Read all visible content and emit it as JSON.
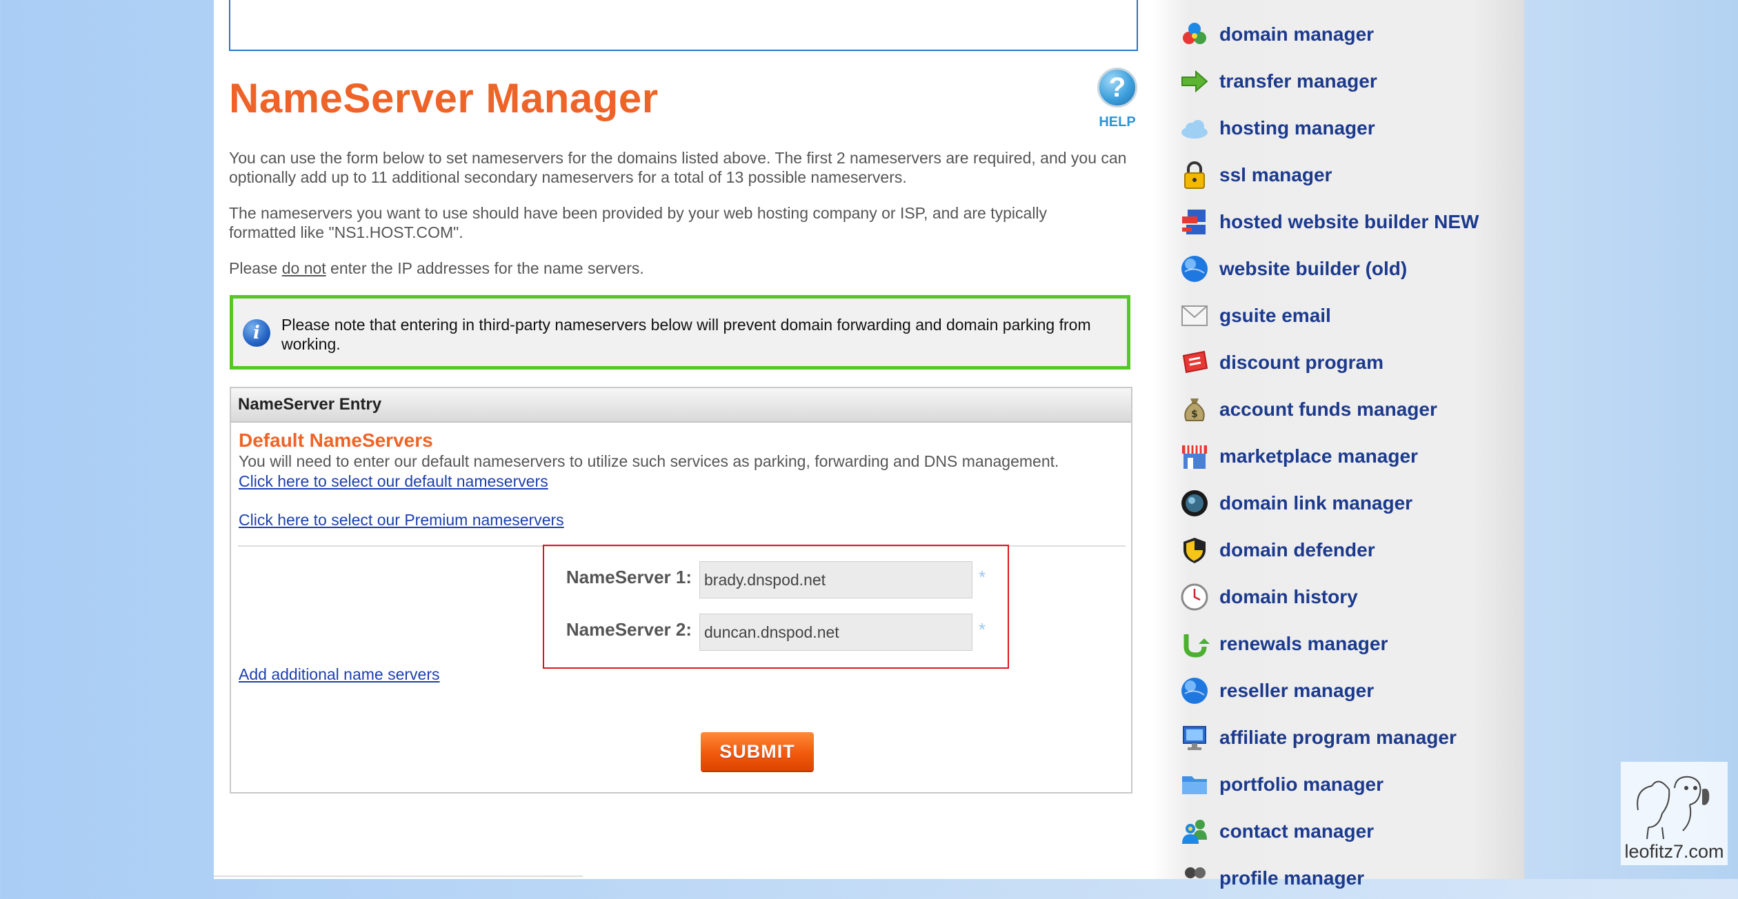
{
  "main": {
    "title": "NameServer Manager",
    "help_label": "HELP",
    "help_icon": "question-mark-icon",
    "paragraph1": "You can use the form below to set nameservers for the domains listed above. The first 2 nameservers are required, and you can optionally add up to 11 additional secondary nameservers for a total of 13 possible nameservers.",
    "paragraph2": "The nameservers you want to use should have been provided by your web hosting company or ISP, and are typically formatted like \"NS1.HOST.COM\".",
    "paragraph3_prefix": "Please ",
    "paragraph3_emphasis": "do not",
    "paragraph3_suffix": " enter the IP addresses for the name servers.",
    "notice": "Please note that entering in third-party nameservers below will prevent domain forwarding and domain parking from working.",
    "notice_icon": "info-icon"
  },
  "entry": {
    "header": "NameServer Entry",
    "default_title": "Default NameServers",
    "default_desc": "You will need to enter our default nameservers to utilize such services as parking, forwarding and DNS management.",
    "link_default": "Click here to select our default nameservers",
    "link_premium": "Click here to select our Premium nameservers",
    "ns1_label": "NameServer 1:",
    "ns1_value": "brady.dnspod.net",
    "ns2_label": "NameServer 2:",
    "ns2_value": "duncan.dnspod.net",
    "required_mark": "*",
    "link_add": "Add additional name servers",
    "submit": "SUBMIT"
  },
  "sidebar": {
    "items": [
      {
        "label": "domain manager",
        "icon": "domain-manager-icon"
      },
      {
        "label": "transfer manager",
        "icon": "arrow-right-icon"
      },
      {
        "label": "hosting manager",
        "icon": "cloud-icon"
      },
      {
        "label": "ssl manager",
        "icon": "padlock-icon"
      },
      {
        "label": "hosted website builder NEW",
        "icon": "website-builder-icon"
      },
      {
        "label": "website builder (old)",
        "icon": "globe-icon"
      },
      {
        "label": "gsuite email",
        "icon": "envelope-icon"
      },
      {
        "label": "discount program",
        "icon": "coupon-icon"
      },
      {
        "label": "account funds manager",
        "icon": "money-bag-icon"
      },
      {
        "label": "marketplace manager",
        "icon": "storefront-icon"
      },
      {
        "label": "domain link manager",
        "icon": "link-globe-icon"
      },
      {
        "label": "domain defender",
        "icon": "shield-icon"
      },
      {
        "label": "domain history",
        "icon": "clock-icon"
      },
      {
        "label": "renewals manager",
        "icon": "renew-arrow-icon"
      },
      {
        "label": "reseller manager",
        "icon": "globe-icon"
      },
      {
        "label": "affiliate program manager",
        "icon": "monitor-icon"
      },
      {
        "label": "portfolio manager",
        "icon": "folder-icon"
      },
      {
        "label": "contact manager",
        "icon": "contacts-icon"
      },
      {
        "label": "profile manager",
        "icon": "profile-icon"
      }
    ]
  },
  "watermark": {
    "text": "leofitz7.com"
  },
  "colors": {
    "title_orange": "#ee6327",
    "sidebar_link": "#1c3a8d",
    "notice_border": "#57c728",
    "highlight_red": "#e0141e",
    "link_blue": "#1d3fae"
  }
}
